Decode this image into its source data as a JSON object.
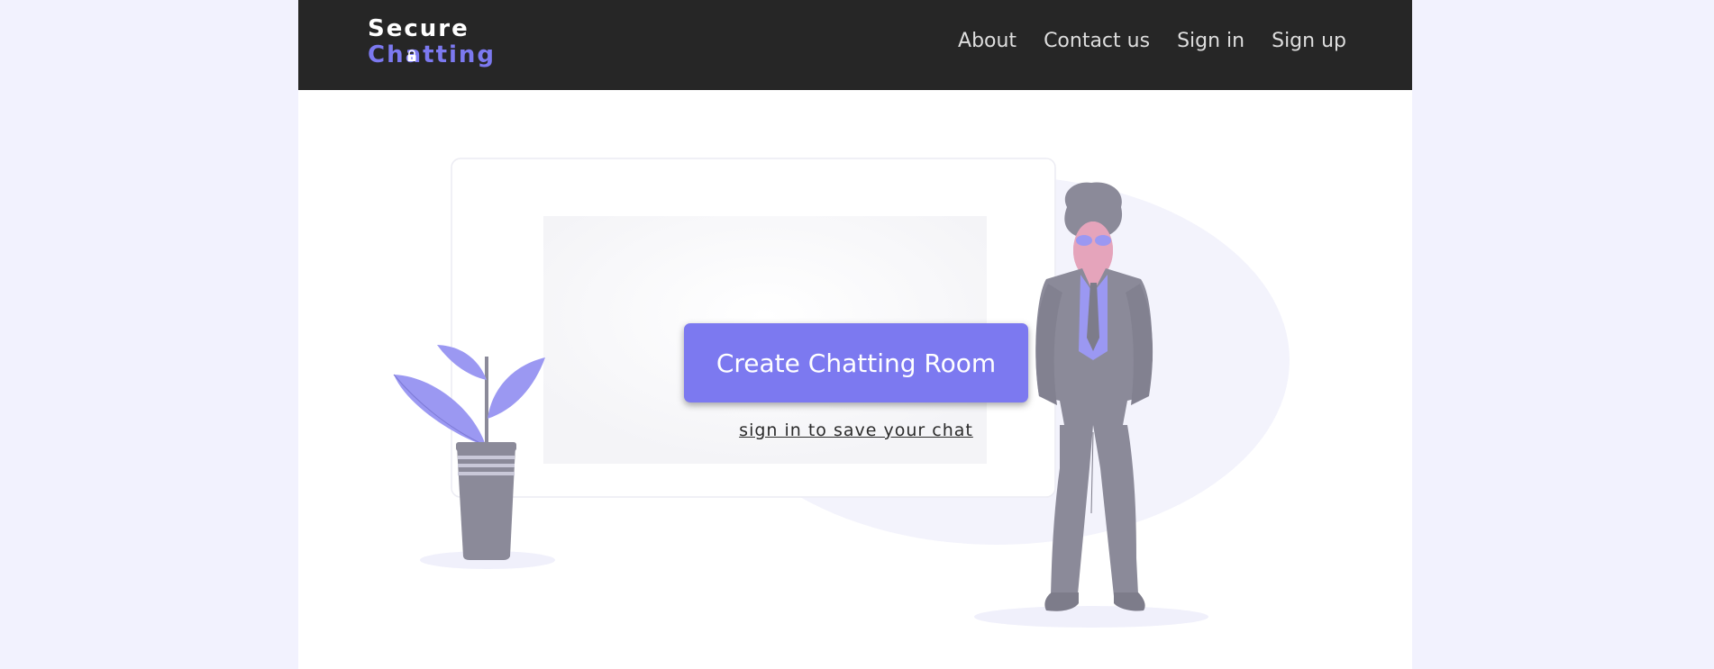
{
  "logo": {
    "line1": "Secure",
    "line2": "Chatting"
  },
  "nav": {
    "about": "About",
    "contact": "Contact us",
    "signin": "Sign in",
    "signup": "Sign up"
  },
  "hero": {
    "cta_label": "Create Chatting Room",
    "signin_hint": "sign in to save your chat"
  },
  "colors": {
    "accent": "#7c79f0",
    "navbar": "#262626",
    "background": "#f2f2fe",
    "figure_gray": "#8b8a99"
  },
  "icons": {
    "logo_lock": "lock-icon",
    "plant": "plant-illustration",
    "person": "person-illustration"
  }
}
